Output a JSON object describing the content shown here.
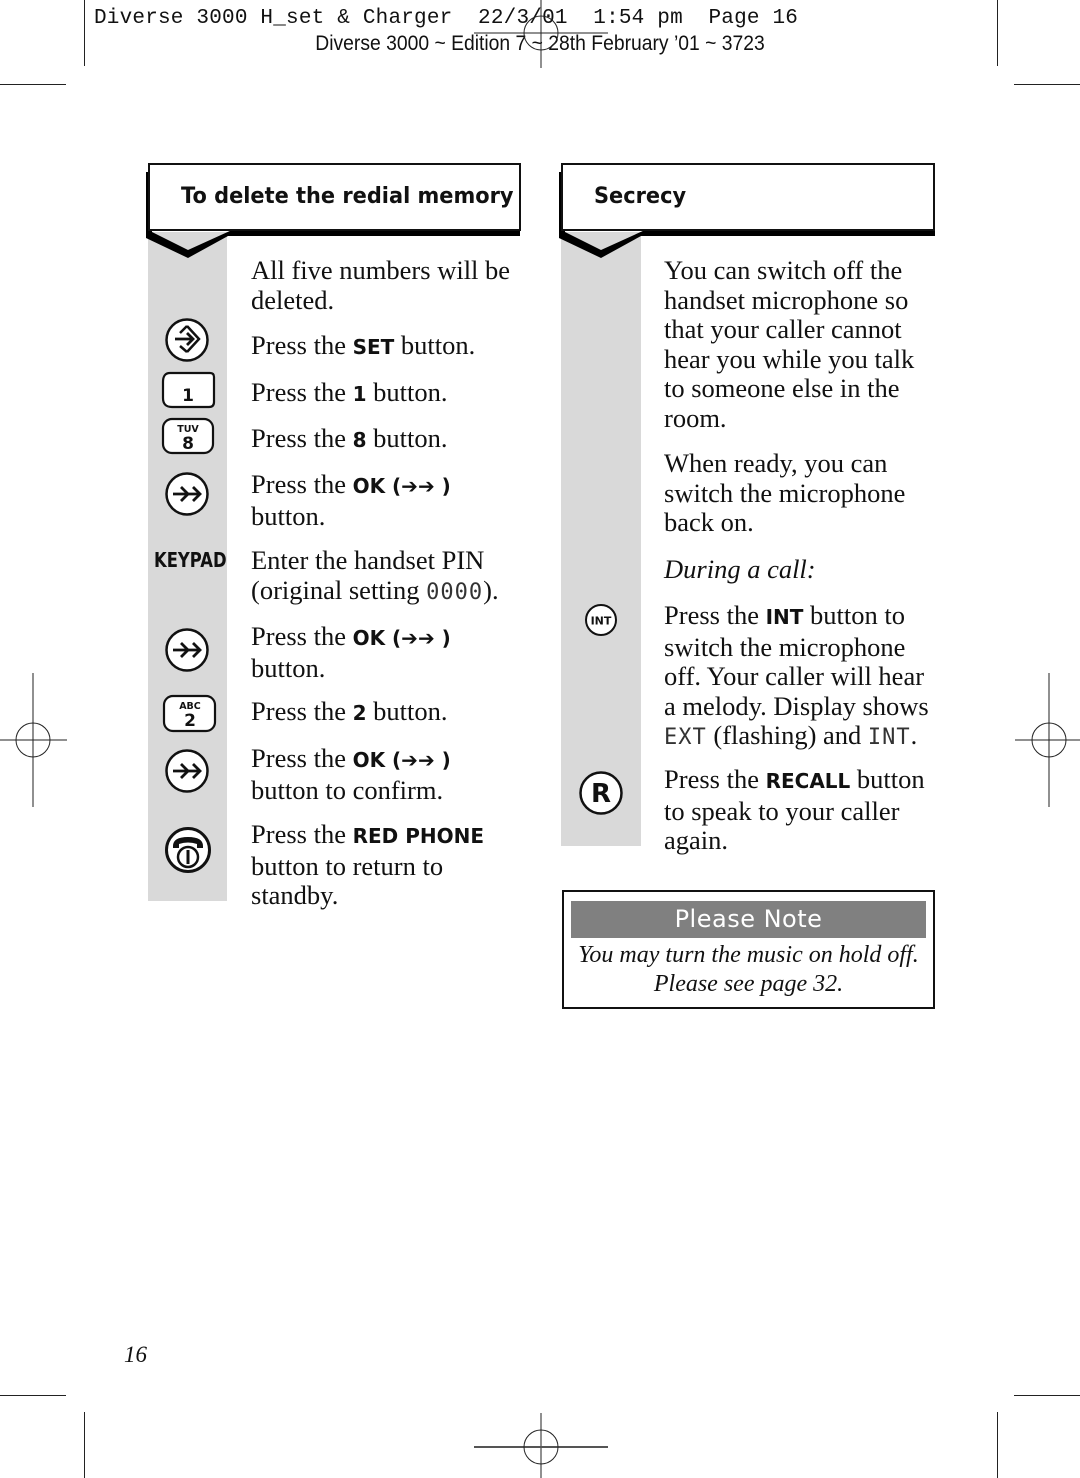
{
  "print_slug": {
    "line1": "Diverse 3000 H_set & Charger  22/3/01  1:54 pm  Page 16",
    "line2": "Diverse 3000 ~ Edition 7 ~ 28th February ’01 ~ 3723"
  },
  "left_section": {
    "title": "To delete the redial memory",
    "steps": [
      {
        "icon": "none",
        "text": "All five numbers will be deleted."
      },
      {
        "icon": "set-button-icon",
        "pre": "Press the ",
        "key": "SET",
        "post": " button."
      },
      {
        "icon": "key-1-icon",
        "key_label": "1",
        "pre": "Press the ",
        "key": "1",
        "post": " button."
      },
      {
        "icon": "key-8-icon",
        "key_letters": "TUV",
        "key_label": "8",
        "pre": "Press the ",
        "key": "8",
        "post": " button."
      },
      {
        "icon": "ok-button-icon",
        "pre": "Press the ",
        "key": "OK (➔➔ )",
        "post": "button."
      },
      {
        "icon": "keypad-label",
        "icon_text": "KEYPAD",
        "pre": "Enter the handset PIN (original setting ",
        "lcd": "0000",
        "post": ")."
      },
      {
        "icon": "ok-button-icon",
        "pre": "Press the ",
        "key": "OK (➔➔ )",
        "post": "button."
      },
      {
        "icon": "key-2-icon",
        "key_letters": "ABC",
        "key_label": "2",
        "pre": "Press the ",
        "key": "2",
        "post": " button."
      },
      {
        "icon": "ok-button-icon",
        "pre": "Press the ",
        "key": "OK (➔➔ )",
        "post": "button to confirm."
      },
      {
        "icon": "red-phone-icon",
        "pre": "Press the ",
        "key": "RED PHONE",
        "post": "button to return to standby."
      }
    ]
  },
  "right_section": {
    "title": "Secrecy",
    "intro1": "You can switch off the handset microphone so that your caller cannot hear you while you talk to someone else in the room.",
    "intro2": "When ready, you can switch the microphone back on.",
    "during_call": "During a call:",
    "steps": [
      {
        "icon": "int-button-icon",
        "icon_text": "INT",
        "pre": "Press the ",
        "key": "INT",
        "mid": " button to switch the microphone off. Your caller will hear a melody. Display shows ",
        "lcd1": "EXT",
        "mid2": " (flashing) and ",
        "lcd2": "INT",
        "post": "."
      },
      {
        "icon": "recall-button-icon",
        "icon_text": "R",
        "pre": "Press the ",
        "key": "RECALL",
        "post": " button to speak to your caller again."
      }
    ]
  },
  "note": {
    "title": "Please Note",
    "line1": "You may turn the music on hold off.",
    "line2": "Please see page 32."
  },
  "page_number": "16",
  "colors": {
    "gray_column": "#d9d9d9",
    "note_header": "#808080",
    "ink": "#111111"
  }
}
